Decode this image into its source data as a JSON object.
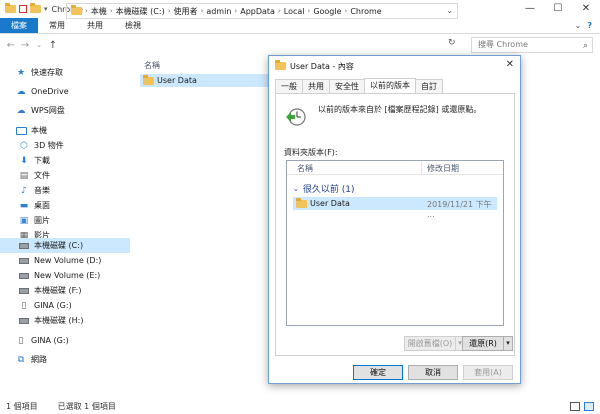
{
  "window": {
    "title": "Chrome",
    "minimize": "—",
    "maximize": "☐",
    "close": "✕"
  },
  "ribbon": {
    "tabs": [
      "檔案",
      "常用",
      "共用",
      "檢視"
    ],
    "expand": "⌄",
    "help": "?"
  },
  "nav": {
    "back": "←",
    "forward": "→",
    "recent": "⌄",
    "up": "↑"
  },
  "address": {
    "segments": [
      "本機",
      "本機磁碟 (C:)",
      "使用者",
      "admin",
      "AppData",
      "Local",
      "Google",
      "Chrome"
    ],
    "separator": "›",
    "dropdown": "⌄",
    "refresh": "↻"
  },
  "search": {
    "placeholder": "搜尋 Chrome",
    "icon": "⌕"
  },
  "sidebar": {
    "items": [
      {
        "label": "快速存取",
        "icon": "star"
      },
      {
        "label": "OneDrive",
        "icon": "cloud"
      },
      {
        "label": "WPS网盘",
        "icon": "cloud"
      },
      {
        "label": "本機",
        "icon": "pc"
      },
      {
        "label": "3D 物件",
        "icon": "cube"
      },
      {
        "label": "下載",
        "icon": "download"
      },
      {
        "label": "文件",
        "icon": "document"
      },
      {
        "label": "音樂",
        "icon": "music"
      },
      {
        "label": "桌面",
        "icon": "desktop"
      },
      {
        "label": "圖片",
        "icon": "picture"
      },
      {
        "label": "影片",
        "icon": "video"
      },
      {
        "label": "本機磁碟 (C:)",
        "icon": "drive"
      },
      {
        "label": "New Volume (D:)",
        "icon": "drive"
      },
      {
        "label": "New Volume (E:)",
        "icon": "drive"
      },
      {
        "label": "本機磁碟 (F:)",
        "icon": "drive"
      },
      {
        "label": "GINA (G:)",
        "icon": "usb"
      },
      {
        "label": "本機磁碟 (H:)",
        "icon": "drive"
      },
      {
        "label": "GINA (G:)",
        "icon": "usb"
      },
      {
        "label": "網路",
        "icon": "network"
      }
    ]
  },
  "content": {
    "column_name": "名稱",
    "files": [
      {
        "name": "User Data"
      }
    ]
  },
  "status": {
    "count": "1 個項目",
    "selected": "已選取 1 個項目"
  },
  "dialog": {
    "title": "User Data - 內容",
    "close": "✕",
    "tabs": [
      "一般",
      "共用",
      "安全性",
      "以前的版本",
      "自訂"
    ],
    "active_tab": 3,
    "description": "以前的版本來自於 [檔案歷程記錄] 或還原點。",
    "list_label": "資料夾版本(F):",
    "columns": {
      "name": "名稱",
      "date": "修改日期"
    },
    "group": {
      "label": "很久以前 (1)",
      "chevron": "⌄"
    },
    "versions": [
      {
        "name": "User Data",
        "date": "2019/11/21 下午 ..."
      }
    ],
    "buttons": {
      "open": "開啟舊檔(O)",
      "restore": "還原(R)",
      "split_arrow": "▾",
      "ok": "確定",
      "cancel": "取消",
      "apply": "套用(A)"
    }
  }
}
